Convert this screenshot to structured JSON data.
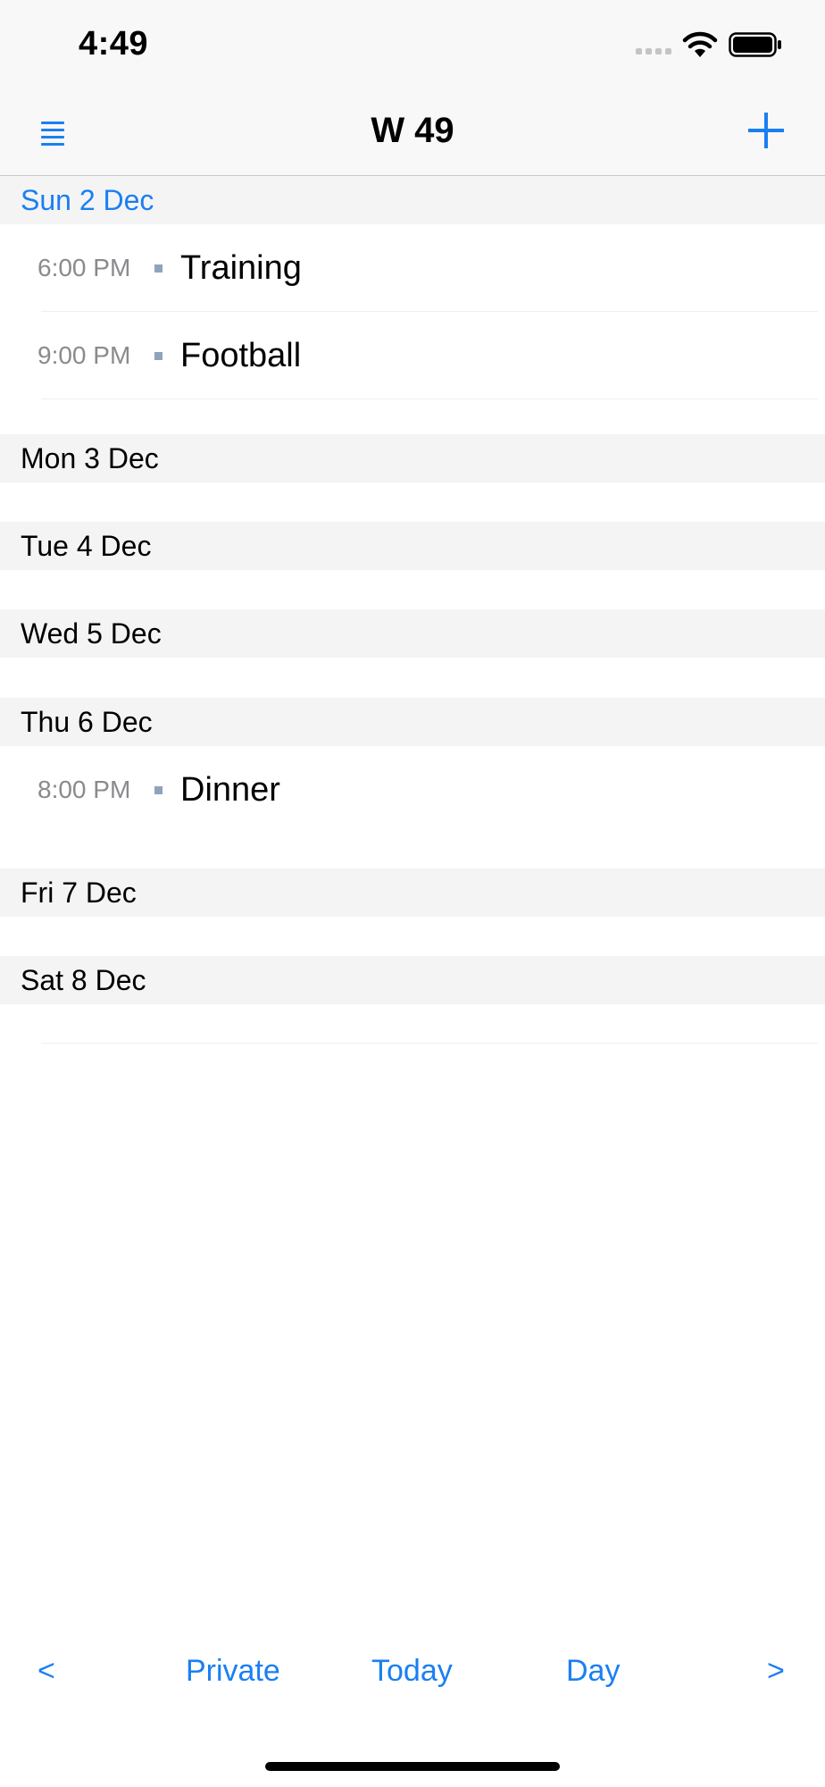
{
  "status_bar": {
    "time": "4:49"
  },
  "nav": {
    "title": "W 49"
  },
  "days": [
    {
      "label": "Sun 2 Dec",
      "is_today": true,
      "events": [
        {
          "time": "6:00 PM",
          "title": "Training"
        },
        {
          "time": "9:00 PM",
          "title": "Football"
        }
      ]
    },
    {
      "label": "Mon 3 Dec",
      "events": []
    },
    {
      "label": "Tue 4 Dec",
      "events": []
    },
    {
      "label": "Wed 5 Dec",
      "events": []
    },
    {
      "label": "Thu 6 Dec",
      "events": [
        {
          "time": "8:00 PM",
          "title": "Dinner"
        }
      ]
    },
    {
      "label": "Fri 7 Dec",
      "events": []
    },
    {
      "label": "Sat 8 Dec",
      "events": []
    }
  ],
  "toolbar": {
    "prev": "<",
    "calendar": "Private",
    "today": "Today",
    "view": "Day",
    "next": ">"
  },
  "colors": {
    "accent": "#1a7ff2",
    "event_dot": "#8fa3bd"
  }
}
